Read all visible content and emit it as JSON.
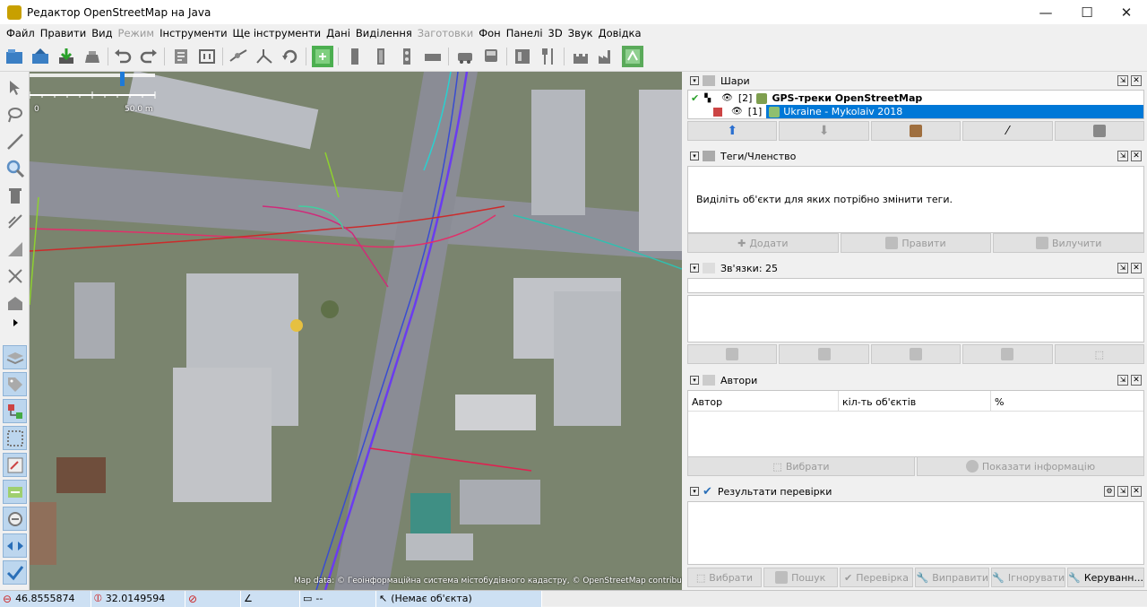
{
  "window": {
    "title": "Редактор OpenStreetMap на Java",
    "min": "—",
    "max": "☐",
    "close": "✕"
  },
  "menu": [
    {
      "label": "Файл",
      "disabled": false
    },
    {
      "label": "Правити",
      "disabled": false
    },
    {
      "label": "Вид",
      "disabled": false
    },
    {
      "label": "Режим",
      "disabled": true
    },
    {
      "label": "Інструменти",
      "disabled": false
    },
    {
      "label": "Ще інструменти",
      "disabled": false
    },
    {
      "label": "Дані",
      "disabled": false
    },
    {
      "label": "Виділення",
      "disabled": false
    },
    {
      "label": "Заготовки",
      "disabled": true
    },
    {
      "label": "Фон",
      "disabled": false
    },
    {
      "label": "Панелі",
      "disabled": false
    },
    {
      "label": "3D",
      "disabled": false
    },
    {
      "label": "Звук",
      "disabled": false
    },
    {
      "label": "Довідка",
      "disabled": false
    }
  ],
  "map": {
    "scale_start": "0",
    "scale_end": "50.0 m",
    "attribution": "Map data: © Геоінформаційна система містобудівного кадастру, © OpenStreetMap contributors"
  },
  "layers": {
    "title": "Шари",
    "rows": [
      {
        "index": "[2]",
        "name": "GPS-треки OpenStreetMap",
        "selected": false
      },
      {
        "index": "[1]",
        "name": "Ukraine - Mykolaiv 2018",
        "selected": true
      }
    ]
  },
  "tags": {
    "title": "Теги/Членство",
    "hint": "Виділіть об'єкти для яких потрібно змінити теги.",
    "add": "Додати",
    "edit": "Правити",
    "delete": "Вилучити"
  },
  "relations": {
    "title": "Зв'язки: 25"
  },
  "authors": {
    "title": "Автори",
    "col_author": "Автор",
    "col_count": "кіл-ть об'єктів",
    "col_percent": "%",
    "select": "Вибрати",
    "show_info": "Показати інформацію"
  },
  "validation": {
    "title": "Результати перевірки",
    "select": "Вибрати",
    "search": "Пошук",
    "validate": "Перевірка",
    "fix": "Виправити",
    "ignore": "Ігнорувати",
    "manage": "Керуванн..."
  },
  "status": {
    "lat": "46.8555874",
    "lon": "32.0149594",
    "distance": "--",
    "object": "(Немає об'єкта)"
  }
}
